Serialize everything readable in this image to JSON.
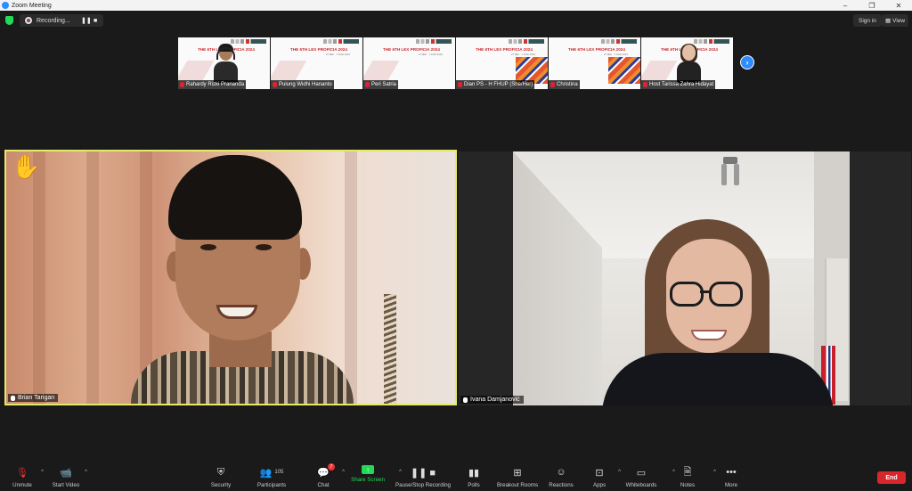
{
  "window": {
    "title": "Zoom Meeting",
    "controls": [
      "–",
      "❐",
      "✕"
    ]
  },
  "topbar": {
    "recording_label": "Recording...",
    "signin_label": "Sign in",
    "view_label": "View"
  },
  "thumbnails": [
    {
      "name": "Rahardy Rizki Prananda",
      "slide_title": "THE 6TH LEX PROFICIA 2024",
      "slide_sub": "27 MEI · 7 JUNI 2024"
    },
    {
      "name": "Pulung Widhi Hananto",
      "slide_title": "THE 6TH LEX PROFICIA 2024",
      "slide_sub": "27 MEI · 7 JUNI 2024"
    },
    {
      "name": "Peri Satria",
      "slide_title": "THE 6TH LEX PROFICIA 2024",
      "slide_sub": "27 MEI · 7 JUNI 2024"
    },
    {
      "name": "Dian PS - H FHUP (She/Her)",
      "slide_title": "THE 6TH LEX PROFICIA 2024",
      "slide_sub": "27 MEI · 7 JUNI 2024"
    },
    {
      "name": "Christina",
      "slide_title": "THE 6TH LEX PROFICIA 2024",
      "slide_sub": "27 MEI · 7 JUNI 2024"
    },
    {
      "name": "Host Tarissa Zahra Hidayat",
      "slide_title": "THE 6TH LEX PROFICIA 2024",
      "slide_sub": "27 MEI · 7 JUNI 2024"
    }
  ],
  "main_videos": [
    {
      "name": "Brian Tarigan"
    },
    {
      "name": "Ivana Damjanović"
    }
  ],
  "toolbar": {
    "unmute": "Unmute",
    "start_video": "Start Video",
    "security": "Security",
    "participants": "Participants",
    "participants_count": "105",
    "chat": "Chat",
    "chat_badge": "7",
    "share_screen": "Share Screen",
    "pause_recording": "Pause/Stop Recording",
    "polls": "Polls",
    "breakout_rooms": "Breakout Rooms",
    "reactions": "Reactions",
    "apps": "Apps",
    "whiteboards": "Whiteboards",
    "notes": "Notes",
    "more": "More",
    "end": "End"
  },
  "colors": {
    "accent": "#2d8cff",
    "share_green": "#23d959",
    "end_red": "#d8272c",
    "active_speaker_border": "#e4e96a",
    "raised_hand": "#f5b625"
  }
}
